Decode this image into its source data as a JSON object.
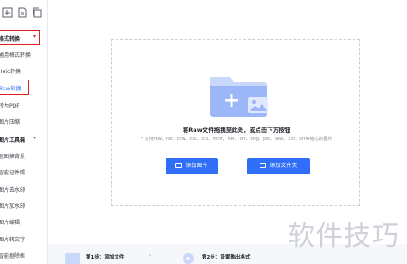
{
  "sidebar": {
    "sections": [
      {
        "label": "格式转换"
      },
      {
        "label": "图片工具箱"
      }
    ],
    "items": [
      {
        "label": "通用格式转换"
      },
      {
        "label": "Heic转换"
      },
      {
        "label": "Raw转换"
      },
      {
        "label": "转为PDF"
      },
      {
        "label": "图片压缩"
      },
      {
        "label": "抠图换背景"
      },
      {
        "label": "智能证件照"
      },
      {
        "label": "图片去水印"
      },
      {
        "label": "图片加水印"
      },
      {
        "label": "图片编辑"
      },
      {
        "label": "图片转文字"
      },
      {
        "label": "智能抠除框"
      }
    ]
  },
  "dropzone": {
    "title": "将Raw文件拖拽至此处，或点击下方按钮",
    "subtitle": "* 支持raw、raf、crw、cr2、cr3、mrw、nef、orf、dng、pef、arw、x3f、srf等格式的图片",
    "add_image_label": "添加图片",
    "add_folder_label": "添加文件夹"
  },
  "steps": {
    "step1": "第1步：添加文件",
    "step2": "第2步：设置输出格式"
  },
  "watermark": {
    "text": "软件技巧"
  },
  "colors": {
    "accent": "#2f6ef7",
    "highlight": "#e02020"
  }
}
